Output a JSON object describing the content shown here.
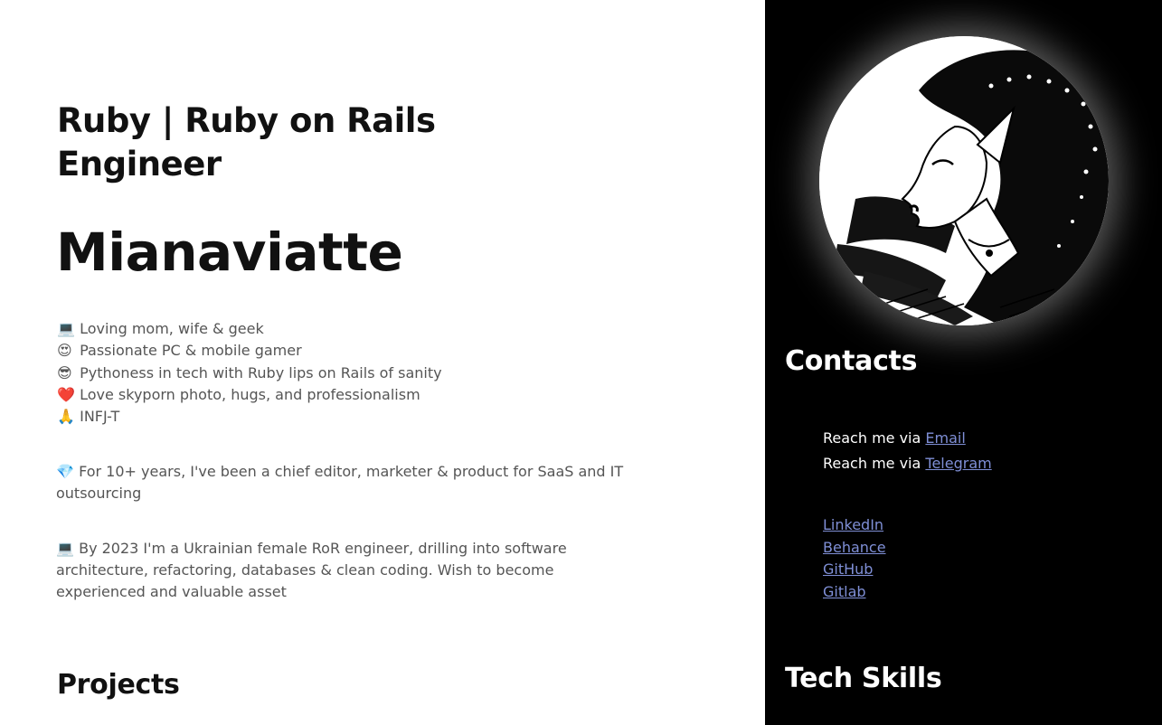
{
  "main": {
    "role_title": "Ruby | Ruby on Rails Engineer",
    "name": "Mianaviatte",
    "bio": [
      {
        "icon": "💻",
        "icon_name": "laptop-icon",
        "text": "Loving mom, wife & geek"
      },
      {
        "icon": "😍",
        "icon_name": "heart-eyes-icon",
        "text": "Passionate PC & mobile gamer"
      },
      {
        "icon": "😎",
        "icon_name": "sunglasses-icon",
        "text": "Pythoness in tech with Ruby lips on Rails of sanity"
      },
      {
        "icon": "❤️",
        "icon_name": "heart-icon",
        "text": "Love skyporn photo, hugs, and professionalism"
      },
      {
        "icon": "🙏",
        "icon_name": "folded-hands-icon",
        "text": "INFJ-T"
      }
    ],
    "paragraph_1": {
      "icon": "💎",
      "icon_name": "gem-icon",
      "text": "For 10+ years, I've been a chief editor, marketer & product for SaaS and IT outsourcing"
    },
    "paragraph_2": {
      "icon": "💻",
      "icon_name": "laptop-icon",
      "text": "By 2023 I'm a Ukrainian female RoR engineer, drilling into software architecture, refactoring, databases & clean coding. Wish to become experienced and valuable asset"
    },
    "projects_title": "Projects"
  },
  "sidebar": {
    "contacts_title": "Contacts",
    "reach": [
      {
        "prefix": "Reach me via ",
        "link": "Email"
      },
      {
        "prefix": "Reach me via ",
        "link": "Telegram"
      }
    ],
    "social_links": [
      "LinkedIn",
      "Behance",
      "GitHub",
      "Gitlab"
    ],
    "tech_skills_title": "Tech Skills"
  },
  "colors": {
    "sidebar_bg": "#000000",
    "link": "#7f8fd6",
    "heading": "#111111",
    "body_text": "#555555"
  }
}
